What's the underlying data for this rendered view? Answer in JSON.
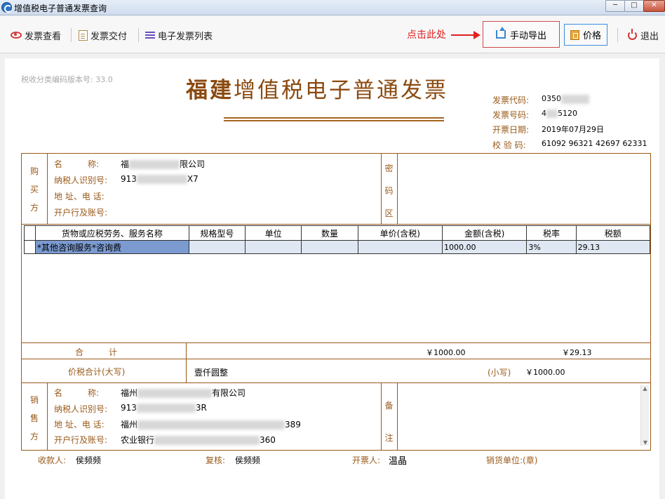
{
  "window": {
    "title": "增值税电子普通发票查询",
    "min": "─",
    "max": "□",
    "close": "✕"
  },
  "toolbar": {
    "view_label": "发票查看",
    "deliver_label": "发票交付",
    "list_label": "电子发票列表",
    "hint": "点击此处",
    "export_label": "手动导出",
    "price_label": "价格",
    "exit_label": "退出"
  },
  "invoice": {
    "version": "税收分类编码版本号: 33.0",
    "title_province": "福建",
    "title_main": "增值税电子普通发票",
    "code_label": "发票代码:",
    "code_value": "0350",
    "number_label": "发票号码:",
    "number_prefix": "4",
    "number_suffix": "5120",
    "date_label": "开票日期:",
    "date_value": "2019年07月29日",
    "check_label": "校 验 码:",
    "check_value": "61092 96321 42697 62331",
    "buyer": {
      "label": [
        "购",
        "买",
        "方"
      ],
      "name_label": "名　　　称:",
      "name_prefix": "福",
      "name_suffix": "限公司",
      "tax_label": "纳税人识别号:",
      "tax_prefix": "913",
      "tax_suffix": "X7",
      "addr_label": "地 址、电 话:",
      "bank_label": "开户行及账号:"
    },
    "secret_label": [
      "密",
      "码",
      "区"
    ],
    "columns": [
      "货物或应税劳务、服务名称",
      "规格型号",
      "单位",
      "数量",
      "单价(含税)",
      "金额(含税)",
      "税率",
      "税额"
    ],
    "rows": [
      {
        "name": "*其他咨询服务*咨询费",
        "spec": "",
        "unit": "",
        "qty": "",
        "price": "",
        "amount": "1000.00",
        "rate": "3%",
        "tax": "29.13"
      }
    ],
    "total_label": "合　　　计",
    "total_amount": "￥1000.00",
    "total_tax": "￥29.13",
    "grand_label": "价税合计(大写)",
    "grand_upper": "壹仟圆整",
    "small_label": "(小写)",
    "grand_small": "￥1000.00",
    "seller": {
      "label": [
        "销",
        "售",
        "方"
      ],
      "name_label": "名　　　称:",
      "name_prefix": "福州",
      "name_suffix": "有限公司",
      "tax_label": "纳税人识别号:",
      "tax_prefix": "913",
      "tax_suffix": "3R",
      "addr_label": "地 址、电 话:",
      "addr_prefix": "福州",
      "addr_suffix": "389",
      "bank_label": "开户行及账号:",
      "bank_prefix": "农业银行",
      "bank_suffix": "360"
    },
    "remark_label": [
      "备",
      "注"
    ],
    "payee_label": "收款人:",
    "payee": "侯频频",
    "reviewer_label": "复核:",
    "reviewer": "侯频频",
    "drawer_label": "开票人:",
    "drawer": "温晶",
    "seal_label": "销货单位:(章)"
  }
}
